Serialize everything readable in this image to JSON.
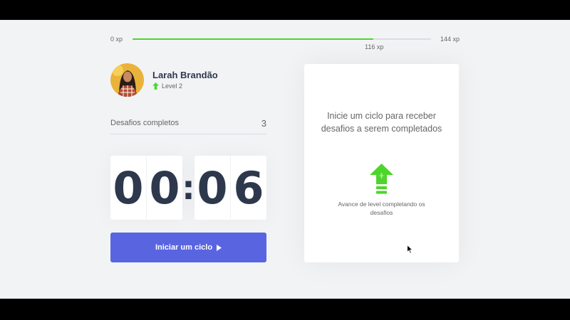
{
  "xp": {
    "start_label": "0 xp",
    "end_label": "144 xp",
    "current_label": "116 xp",
    "progress_fraction": 0.806
  },
  "profile": {
    "name": "Larah Brandão",
    "level_label": "Level 2",
    "avatar_icon": "user-photo"
  },
  "challenges": {
    "label": "Desafios completos",
    "count": "3"
  },
  "countdown": {
    "minutes": [
      "0",
      "0"
    ],
    "separator": ":",
    "seconds": [
      "0",
      "6"
    ]
  },
  "start_button": {
    "label": "Iniciar um ciclo",
    "icon": "play-icon"
  },
  "challenge_card": {
    "title": "Inicie um ciclo para receber desafios a serem completados",
    "subtitle": "Avance de level completando os desafios",
    "icon": "level-up-icon"
  },
  "colors": {
    "accent_green": "#4cd62b",
    "button_blue": "#5965e0",
    "title_text": "#2e384d",
    "body_text": "#666666",
    "background": "#f2f3f5"
  }
}
